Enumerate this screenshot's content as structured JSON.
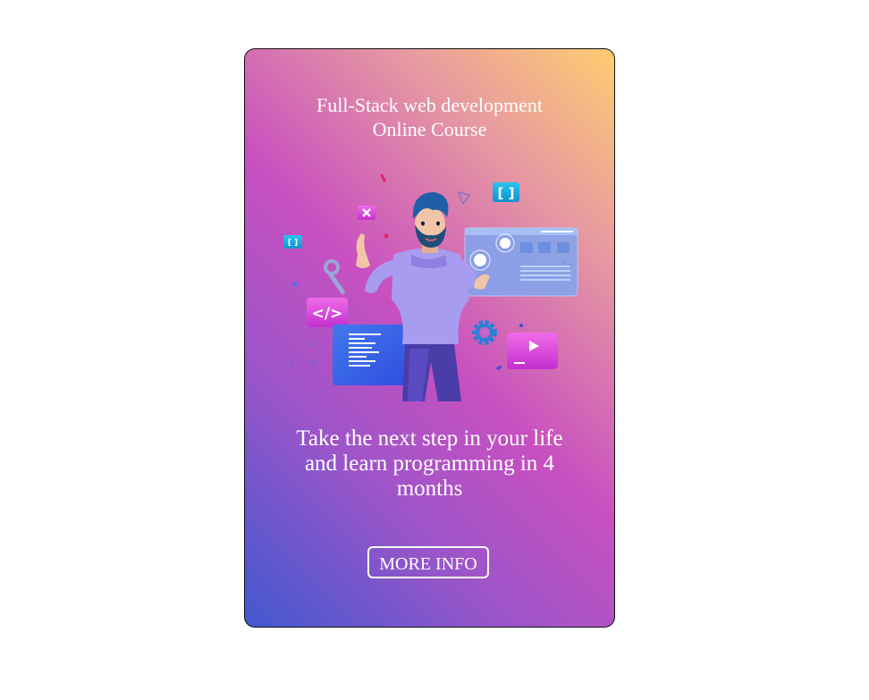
{
  "card": {
    "title_line1": "Full-Stack web development",
    "title_line2": "Online Course",
    "illustration_icons": [
      "developer-character-icon",
      "code-tag-icon",
      "close-icon",
      "brackets-icon",
      "gear-icon",
      "play-icon",
      "wrench-icon",
      "code-document-icon",
      "dashboard-window-icon"
    ],
    "tagline_line1": "Take the next step in your life",
    "tagline_line2": "and learn programming in 4",
    "tagline_line3": "months",
    "button_label": "MORE INFO"
  },
  "colors": {
    "gradient_start": "#ffcc70",
    "gradient_mid": "#c850c0",
    "gradient_end": "#4158d0",
    "text": "#ffffff"
  }
}
